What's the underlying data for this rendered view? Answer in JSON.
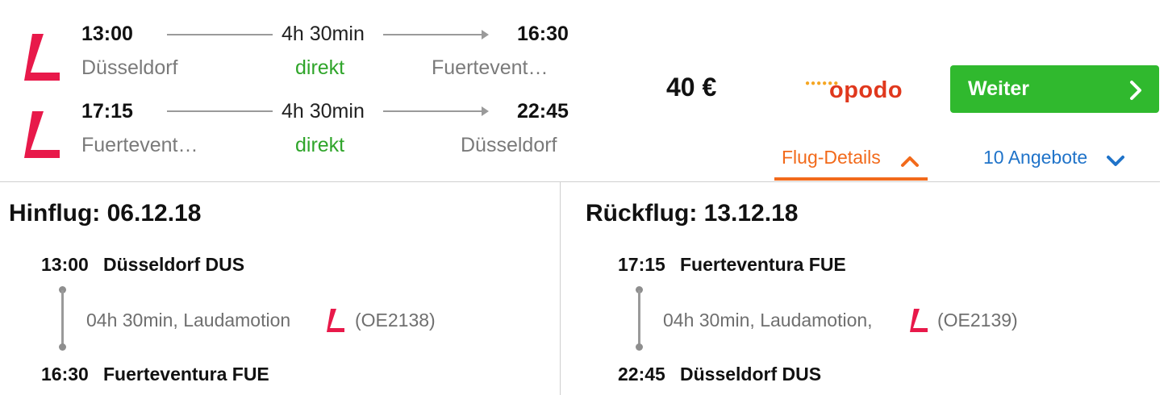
{
  "outbound_summary": {
    "dep_time": "13:00",
    "arr_time": "16:30",
    "duration": "4h 30min",
    "stops": "direkt",
    "dep_city": "Düsseldorf",
    "arr_city": "Fuertevent…"
  },
  "return_summary": {
    "dep_time": "17:15",
    "arr_time": "22:45",
    "duration": "4h 30min",
    "stops": "direkt",
    "dep_city": "Fuertevent…",
    "arr_city": "Düsseldorf"
  },
  "offer": {
    "price": "40 €",
    "provider": "opodo",
    "button_label": "Weiter",
    "button_icon": "chevron-right-icon"
  },
  "tabs": {
    "details_label": "Flug-Details",
    "offers_label": "10 Angebote"
  },
  "outbound_detail": {
    "title": "Hinflug: 06.12.18",
    "dep_time": "13:00",
    "dep_airport": "Düsseldorf DUS",
    "info_text": "04h 30min, Laudamotion",
    "flight_no": "(OE2138)",
    "arr_time": "16:30",
    "arr_airport": "Fuerteventura FUE"
  },
  "return_detail": {
    "title": "Rückflug: 13.12.18",
    "dep_time": "17:15",
    "dep_airport": "Fuerteventura FUE",
    "info_text": "04h 30min, Laudamotion,",
    "flight_no": "(OE2139)",
    "arr_time": "22:45",
    "arr_airport": "Düsseldorf DUS"
  },
  "colors": {
    "airline_logo": "#e8194a",
    "accent_green": "#30b92e",
    "direct_green": "#2fa52a",
    "tab_orange": "#f26a1b",
    "link_blue": "#1f73c9"
  }
}
